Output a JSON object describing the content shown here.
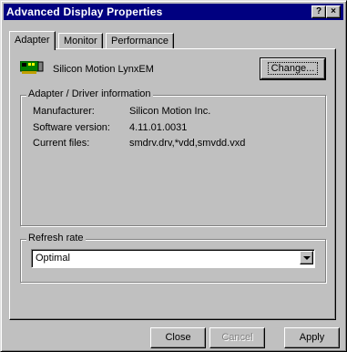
{
  "window": {
    "title": "Advanced Display Properties"
  },
  "titlebar_buttons": {
    "help": "?",
    "close": "×"
  },
  "tabs": [
    {
      "label": "Adapter",
      "active": true
    },
    {
      "label": "Monitor",
      "active": false
    },
    {
      "label": "Performance",
      "active": false
    }
  ],
  "adapter": {
    "name": "Silicon Motion LynxEM",
    "icon": "display-adapter-card-icon",
    "change_button": "Change..."
  },
  "driver_info": {
    "legend": "Adapter / Driver information",
    "manufacturer_label": "Manufacturer:",
    "manufacturer_value": "Silicon Motion Inc.",
    "software_label": "Software version:",
    "software_value": "4.11.01.0031",
    "files_label": "Current files:",
    "files_value": "smdrv.drv,*vdd,smvdd.vxd"
  },
  "refresh_rate": {
    "legend": "Refresh rate",
    "selected": "Optimal"
  },
  "buttons": {
    "close": "Close",
    "cancel": "Cancel",
    "apply": "Apply"
  }
}
